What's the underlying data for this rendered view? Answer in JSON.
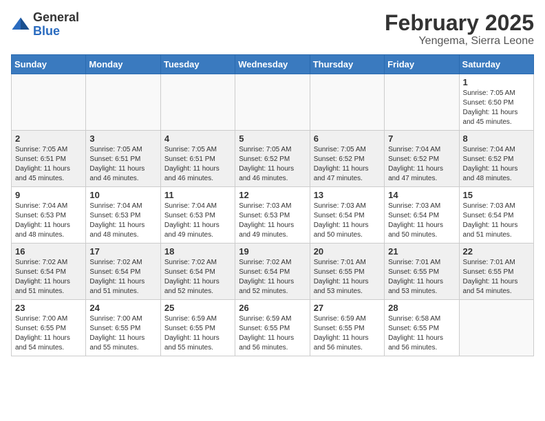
{
  "logo": {
    "general": "General",
    "blue": "Blue"
  },
  "header": {
    "month": "February 2025",
    "location": "Yengema, Sierra Leone"
  },
  "weekdays": [
    "Sunday",
    "Monday",
    "Tuesday",
    "Wednesday",
    "Thursday",
    "Friday",
    "Saturday"
  ],
  "weeks": [
    [
      {
        "day": "",
        "info": ""
      },
      {
        "day": "",
        "info": ""
      },
      {
        "day": "",
        "info": ""
      },
      {
        "day": "",
        "info": ""
      },
      {
        "day": "",
        "info": ""
      },
      {
        "day": "",
        "info": ""
      },
      {
        "day": "1",
        "info": "Sunrise: 7:05 AM\nSunset: 6:50 PM\nDaylight: 11 hours and 45 minutes."
      }
    ],
    [
      {
        "day": "2",
        "info": "Sunrise: 7:05 AM\nSunset: 6:51 PM\nDaylight: 11 hours and 45 minutes."
      },
      {
        "day": "3",
        "info": "Sunrise: 7:05 AM\nSunset: 6:51 PM\nDaylight: 11 hours and 46 minutes."
      },
      {
        "day": "4",
        "info": "Sunrise: 7:05 AM\nSunset: 6:51 PM\nDaylight: 11 hours and 46 minutes."
      },
      {
        "day": "5",
        "info": "Sunrise: 7:05 AM\nSunset: 6:52 PM\nDaylight: 11 hours and 46 minutes."
      },
      {
        "day": "6",
        "info": "Sunrise: 7:05 AM\nSunset: 6:52 PM\nDaylight: 11 hours and 47 minutes."
      },
      {
        "day": "7",
        "info": "Sunrise: 7:04 AM\nSunset: 6:52 PM\nDaylight: 11 hours and 47 minutes."
      },
      {
        "day": "8",
        "info": "Sunrise: 7:04 AM\nSunset: 6:52 PM\nDaylight: 11 hours and 48 minutes."
      }
    ],
    [
      {
        "day": "9",
        "info": "Sunrise: 7:04 AM\nSunset: 6:53 PM\nDaylight: 11 hours and 48 minutes."
      },
      {
        "day": "10",
        "info": "Sunrise: 7:04 AM\nSunset: 6:53 PM\nDaylight: 11 hours and 48 minutes."
      },
      {
        "day": "11",
        "info": "Sunrise: 7:04 AM\nSunset: 6:53 PM\nDaylight: 11 hours and 49 minutes."
      },
      {
        "day": "12",
        "info": "Sunrise: 7:03 AM\nSunset: 6:53 PM\nDaylight: 11 hours and 49 minutes."
      },
      {
        "day": "13",
        "info": "Sunrise: 7:03 AM\nSunset: 6:54 PM\nDaylight: 11 hours and 50 minutes."
      },
      {
        "day": "14",
        "info": "Sunrise: 7:03 AM\nSunset: 6:54 PM\nDaylight: 11 hours and 50 minutes."
      },
      {
        "day": "15",
        "info": "Sunrise: 7:03 AM\nSunset: 6:54 PM\nDaylight: 11 hours and 51 minutes."
      }
    ],
    [
      {
        "day": "16",
        "info": "Sunrise: 7:02 AM\nSunset: 6:54 PM\nDaylight: 11 hours and 51 minutes."
      },
      {
        "day": "17",
        "info": "Sunrise: 7:02 AM\nSunset: 6:54 PM\nDaylight: 11 hours and 51 minutes."
      },
      {
        "day": "18",
        "info": "Sunrise: 7:02 AM\nSunset: 6:54 PM\nDaylight: 11 hours and 52 minutes."
      },
      {
        "day": "19",
        "info": "Sunrise: 7:02 AM\nSunset: 6:54 PM\nDaylight: 11 hours and 52 minutes."
      },
      {
        "day": "20",
        "info": "Sunrise: 7:01 AM\nSunset: 6:55 PM\nDaylight: 11 hours and 53 minutes."
      },
      {
        "day": "21",
        "info": "Sunrise: 7:01 AM\nSunset: 6:55 PM\nDaylight: 11 hours and 53 minutes."
      },
      {
        "day": "22",
        "info": "Sunrise: 7:01 AM\nSunset: 6:55 PM\nDaylight: 11 hours and 54 minutes."
      }
    ],
    [
      {
        "day": "23",
        "info": "Sunrise: 7:00 AM\nSunset: 6:55 PM\nDaylight: 11 hours and 54 minutes."
      },
      {
        "day": "24",
        "info": "Sunrise: 7:00 AM\nSunset: 6:55 PM\nDaylight: 11 hours and 55 minutes."
      },
      {
        "day": "25",
        "info": "Sunrise: 6:59 AM\nSunset: 6:55 PM\nDaylight: 11 hours and 55 minutes."
      },
      {
        "day": "26",
        "info": "Sunrise: 6:59 AM\nSunset: 6:55 PM\nDaylight: 11 hours and 56 minutes."
      },
      {
        "day": "27",
        "info": "Sunrise: 6:59 AM\nSunset: 6:55 PM\nDaylight: 11 hours and 56 minutes."
      },
      {
        "day": "28",
        "info": "Sunrise: 6:58 AM\nSunset: 6:55 PM\nDaylight: 11 hours and 56 minutes."
      },
      {
        "day": "",
        "info": ""
      }
    ]
  ]
}
